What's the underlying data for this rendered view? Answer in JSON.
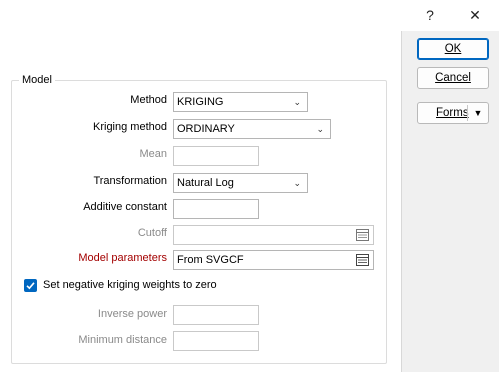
{
  "titlebar": {
    "help_glyph": "?",
    "close_glyph": "✕"
  },
  "buttons": {
    "ok": "OK",
    "cancel": "Cancel",
    "forms": "Forms"
  },
  "group": {
    "title": "Model"
  },
  "fields": {
    "method": {
      "label": "Method",
      "value": "KRIGING"
    },
    "kriging_method": {
      "label": "Kriging method",
      "value": "ORDINARY"
    },
    "mean": {
      "label": "Mean",
      "value": ""
    },
    "transformation": {
      "label": "Transformation",
      "value": "Natural Log"
    },
    "additive_constant": {
      "label": "Additive constant",
      "value": ""
    },
    "cutoff": {
      "label": "Cutoff",
      "value": ""
    },
    "model_parameters": {
      "label": "Model parameters",
      "value": "From SVGCF"
    },
    "set_negative": {
      "label": "Set negative kriging weights to zero",
      "checked": true
    },
    "inverse_power": {
      "label": "Inverse power",
      "value": ""
    },
    "minimum_distance": {
      "label": "Minimum distance",
      "value": ""
    }
  },
  "colors": {
    "accent": "#0067c0",
    "required_label": "#a30000"
  }
}
